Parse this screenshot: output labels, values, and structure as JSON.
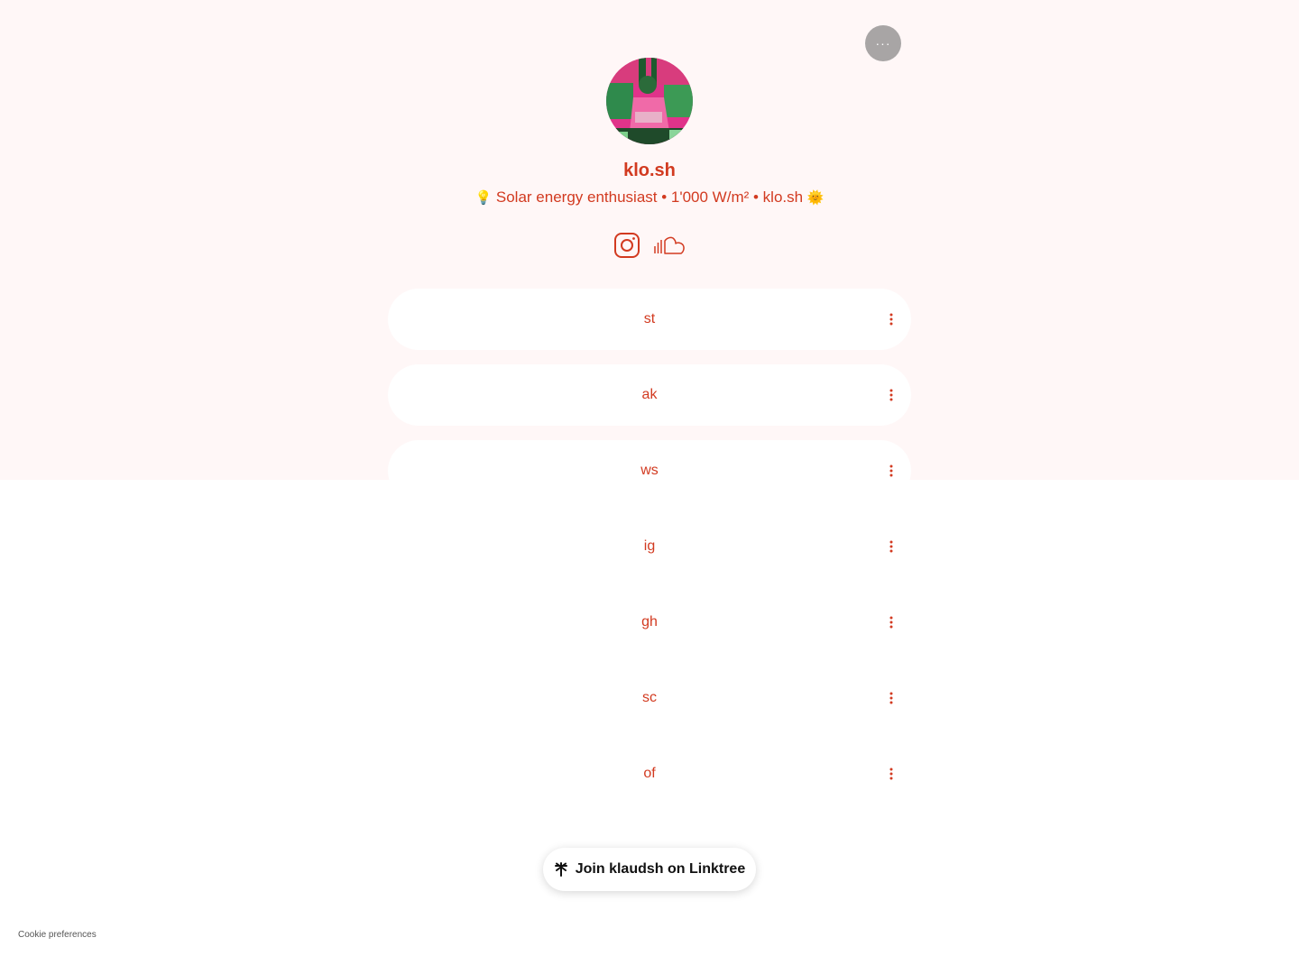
{
  "profile": {
    "username": "klo.sh",
    "bio_lead_emoji": "💡",
    "bio_text": "Solar energy enthusiast • 1'000 W/m² • klo.sh",
    "bio_trail_emoji": "🌞"
  },
  "header": {
    "more_label": "···"
  },
  "socials": [
    {
      "icon": "instagram-icon"
    },
    {
      "icon": "soundcloud-icon"
    }
  ],
  "links": [
    {
      "label": "st"
    },
    {
      "label": "ak"
    },
    {
      "label": "ws"
    },
    {
      "label": "ig"
    },
    {
      "label": "gh"
    },
    {
      "label": "sc"
    },
    {
      "label": "of"
    }
  ],
  "footer": {
    "join_label": "Join klaudsh on Linktree",
    "cookie_label": "Cookie preferences"
  },
  "colors": {
    "accent": "#d23a20",
    "background_top": "#fff7f7",
    "background_bottom": "#ffffff"
  }
}
